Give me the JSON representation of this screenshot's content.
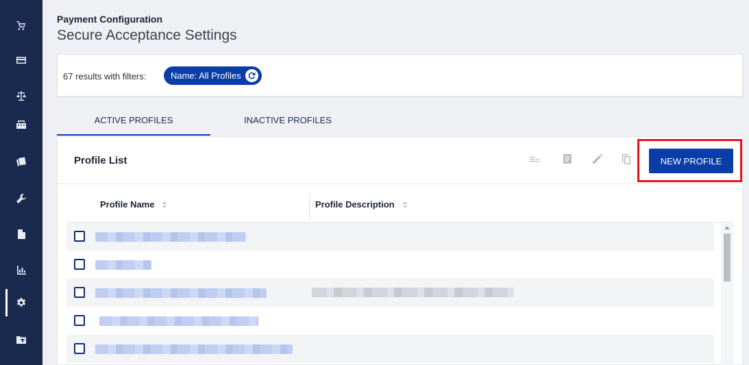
{
  "header": {
    "kicker": "Payment Configuration",
    "title": "Secure Acceptance Settings"
  },
  "filters": {
    "count_text": "67 results with filters:",
    "chip_label": "Name: All Profiles"
  },
  "tabs": [
    {
      "label": "ACTIVE PROFILES",
      "active": true
    },
    {
      "label": "INACTIVE PROFILES",
      "active": false
    }
  ],
  "panel": {
    "title": "Profile List",
    "new_button": "NEW PROFILE"
  },
  "table": {
    "columns": [
      "Profile Name",
      "Profile Description"
    ],
    "row_count_visible": 5
  },
  "sidebar": {
    "items": [
      "cart-icon",
      "card-icon",
      "scales-icon",
      "register-icon",
      "payment-cards-icon",
      "wrench-icon",
      "document-icon",
      "bar-chart-icon",
      "gear-icon",
      "folder-icon"
    ],
    "active_item": "gear-icon"
  },
  "colors": {
    "sidebar": "#1a2a4f",
    "primary": "#0b3da6",
    "highlight": "#e8141b"
  }
}
